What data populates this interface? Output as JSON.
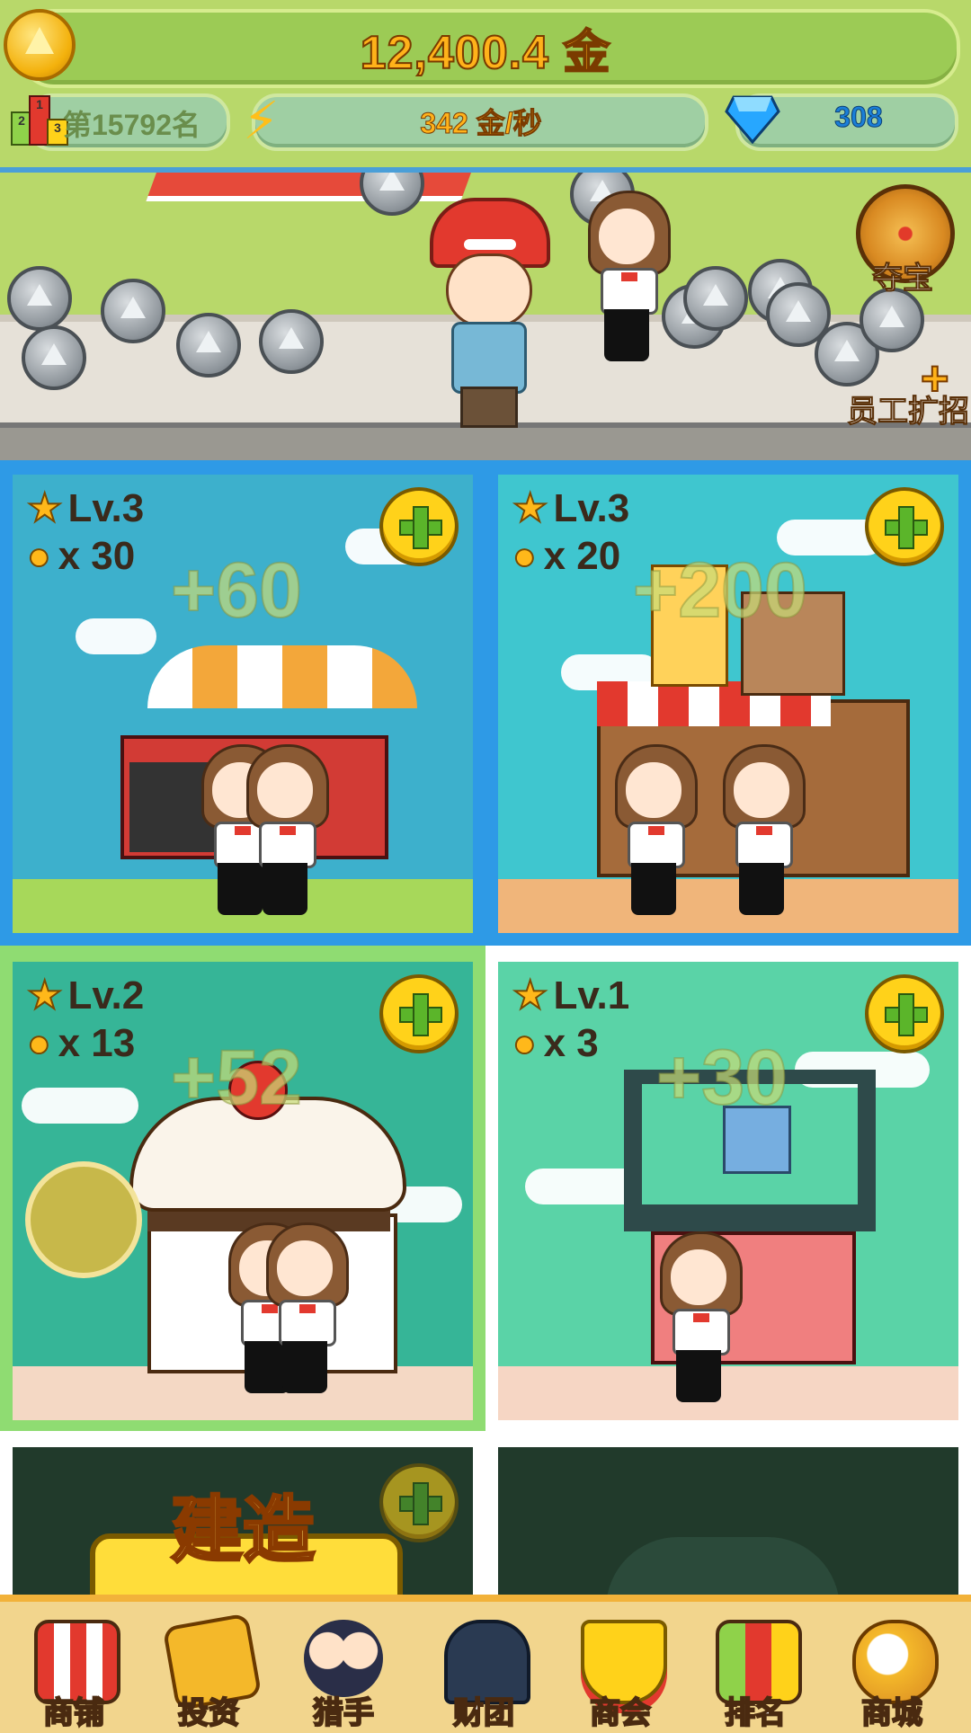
{
  "hud": {
    "gold_amount": "12,400.4 金",
    "rank_text": "第15792名",
    "podium_numbers": [
      "2",
      "1",
      "3"
    ],
    "income_rate": "342 金/秒",
    "gems": "308"
  },
  "street": {
    "treasure_label": "夺宝",
    "hire_label": "员工扩招"
  },
  "shops": [
    {
      "level": "Lv.3",
      "staff": "x 30",
      "gain": "+60"
    },
    {
      "level": "Lv.3",
      "staff": "x 20",
      "gain": "+200"
    },
    {
      "level": "Lv.2",
      "staff": "x 13",
      "gain": "+52"
    },
    {
      "level": "Lv.1",
      "staff": "x 3",
      "gain": "+30"
    }
  ],
  "build": {
    "label": "建造"
  },
  "nav": [
    "商铺",
    "投资",
    "猎手",
    "财团",
    "商会",
    "排名",
    "商城"
  ],
  "colors": {
    "accent_gold": "#ffb21a",
    "card_blue": "#2e9ae6",
    "card_green": "#8fdc72"
  }
}
